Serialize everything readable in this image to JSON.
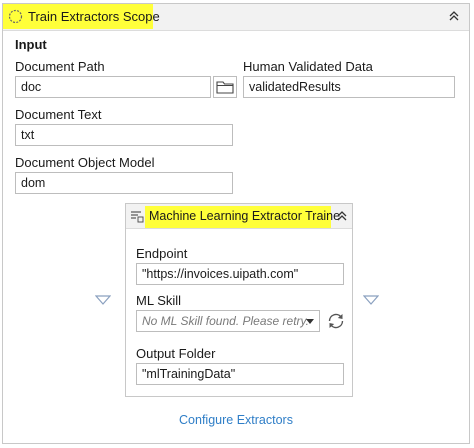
{
  "scope": {
    "title": "Train Extractors Scope",
    "section_title": "Input",
    "document_path": {
      "label": "Document Path",
      "value": "doc"
    },
    "human_validated_data": {
      "label": "Human Validated Data",
      "value": "validatedResults"
    },
    "document_text": {
      "label": "Document Text",
      "value": "txt"
    },
    "document_object_model": {
      "label": "Document Object Model",
      "value": "dom"
    },
    "configure_link": "Configure Extractors"
  },
  "extractor": {
    "title": "Machine Learning Extractor Traine",
    "endpoint": {
      "label": "Endpoint",
      "value": "\"https://invoices.uipath.com\""
    },
    "ml_skill": {
      "label": "ML Skill",
      "placeholder": "No ML Skill found. Please retry."
    },
    "output_folder": {
      "label": "Output Folder",
      "value": "\"mlTrainingData\""
    }
  },
  "colors": {
    "highlight": "#ffff3a",
    "link": "#2f7ec7"
  },
  "icons": [
    "activity-scope-icon",
    "collapse-chevron-icon",
    "folder-icon",
    "expand-arrow-icon",
    "extractor-activity-icon",
    "dropdown-caret-icon",
    "refresh-icon"
  ]
}
